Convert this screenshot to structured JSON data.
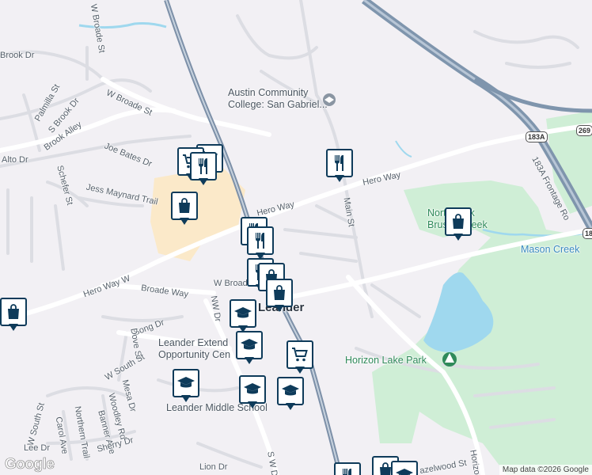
{
  "map": {
    "colors": {
      "background": "#f2f0f4",
      "park": "#cfeed6",
      "water": "#9fd8ee",
      "railway": "#7d90a8",
      "highway": "#7f95ad",
      "marker": "#0e3b5a",
      "commercial": "#fbe9c9"
    },
    "labels": {
      "acc": "Austin Community\nCollege: San Gabriel...",
      "hero_way_top": "Hero Way",
      "hero_way_mid": "Hero Way",
      "hero_way_w": "Hero Way W",
      "main_st": "Main St",
      "w_broade_st_top": "W Broade St",
      "w_broade_st_mid": "W Broade St",
      "w_broad": "W Broad",
      "broade_way": "Broade Way",
      "brook_dr": "Brook Dr",
      "palmilla_st": "Palmilla St",
      "s_brook_dr": "S Brook Dr",
      "brook_alley": "Brook Alley",
      "alto_dr": "Alto Dr",
      "joe_bates_dr": "Joe Bates Dr",
      "jess_maynard": "Jess Maynard Trail",
      "schefer_st": "Schefer St",
      "song_dr": "Song Dr",
      "dove_st": "Dove St",
      "w_south_st_a": "W South St",
      "w_south_st_b": "W South St",
      "mesa_dr": "Mesa Dr",
      "woodley_rd": "Woodley Rd",
      "banner_ave": "Banner Ave",
      "northern_trail": "Northern Trail",
      "carol_ave": "Carol Ave",
      "sherry_dr": "Sherry Dr",
      "lee_dr": "Lee Dr",
      "lion_dr": "Lion Dr",
      "nw_dr": "NW Dr",
      "s_w_dr": "S W D",
      "leander": "Leander",
      "leander_extend": "Leander Extend\nOpportunity Cen",
      "leander_middle": "Leander Middle School",
      "horizon_lake_park": "Horizon Lake Park",
      "horizon": "Horizo",
      "hazelwood": "azelwood St",
      "mason_creek": "Mason Creek",
      "north_park": "North Park\nBrushy Creek",
      "frontage": "183A Frontage Ro",
      "shield_183a": "183A",
      "shield_269": "269",
      "shield_183": "183",
      "google": "Google",
      "map_data": "Map data ©2026 Google"
    },
    "markers": [
      {
        "type": "restaurant",
        "icon": "fork-knife-icon"
      },
      {
        "type": "grocery",
        "icon": "shopping-cart-icon"
      },
      {
        "type": "grocery",
        "icon": "shopping-cart-icon"
      },
      {
        "type": "restaurant",
        "icon": "fork-knife-icon"
      },
      {
        "type": "shopping",
        "icon": "shopping-bag-icon"
      },
      {
        "type": "restaurant",
        "icon": "fork-knife-icon"
      },
      {
        "type": "restaurant",
        "icon": "fork-knife-icon"
      },
      {
        "type": "restaurant",
        "icon": "fork-knife-icon"
      },
      {
        "type": "shopping",
        "icon": "shopping-bag-icon"
      },
      {
        "type": "shopping",
        "icon": "shopping-bag-icon"
      },
      {
        "type": "school",
        "icon": "graduation-cap-icon"
      },
      {
        "type": "school",
        "icon": "graduation-cap-icon"
      },
      {
        "type": "grocery",
        "icon": "shopping-cart-icon"
      },
      {
        "type": "school",
        "icon": "graduation-cap-icon"
      },
      {
        "type": "school",
        "icon": "graduation-cap-icon"
      },
      {
        "type": "school",
        "icon": "graduation-cap-icon"
      },
      {
        "type": "shopping",
        "icon": "shopping-bag-icon"
      },
      {
        "type": "shopping",
        "icon": "shopping-bag-icon"
      },
      {
        "type": "restaurant",
        "icon": "fork-knife-icon"
      },
      {
        "type": "shopping",
        "icon": "shopping-bag-icon"
      },
      {
        "type": "school",
        "icon": "graduation-cap-icon"
      }
    ]
  }
}
